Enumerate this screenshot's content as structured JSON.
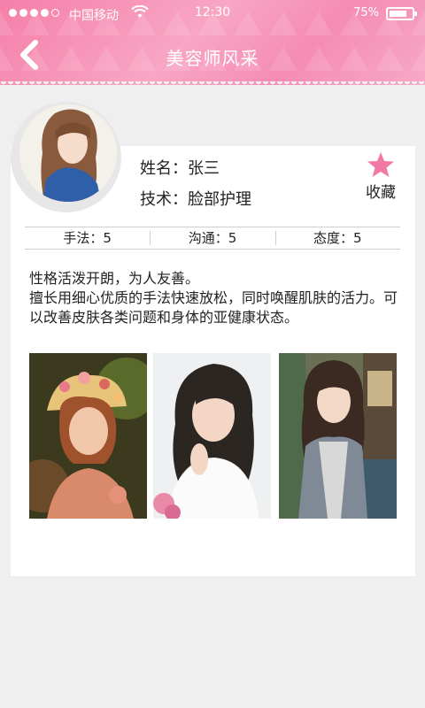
{
  "status_bar": {
    "carrier": "中国移动",
    "time": "12:30",
    "battery": "75%",
    "battery_level": 0.75,
    "signal_bars": 4
  },
  "nav": {
    "title": "美容师风采",
    "back_icon": "chevron-left-icon"
  },
  "profile": {
    "name_line": "姓名：张三",
    "skill_line": "技术：脸部护理",
    "favorite_label": "收藏",
    "favorite_icon": "star-icon",
    "favorite_color": "#f07aa5"
  },
  "ratings": [
    {
      "label": "手法：5"
    },
    {
      "label": "沟通：5"
    },
    {
      "label": "态度：5"
    }
  ],
  "description": {
    "line1": "性格活泼开朗，为人友善。",
    "line2": "擅长用细心优质的手法快速放松，同时唤醒肌肤的活力。可以改善皮肤各类问题和身体的亚健康状态。"
  },
  "theme": {
    "header_pink": "#f58cb3",
    "background": "#efefef"
  }
}
